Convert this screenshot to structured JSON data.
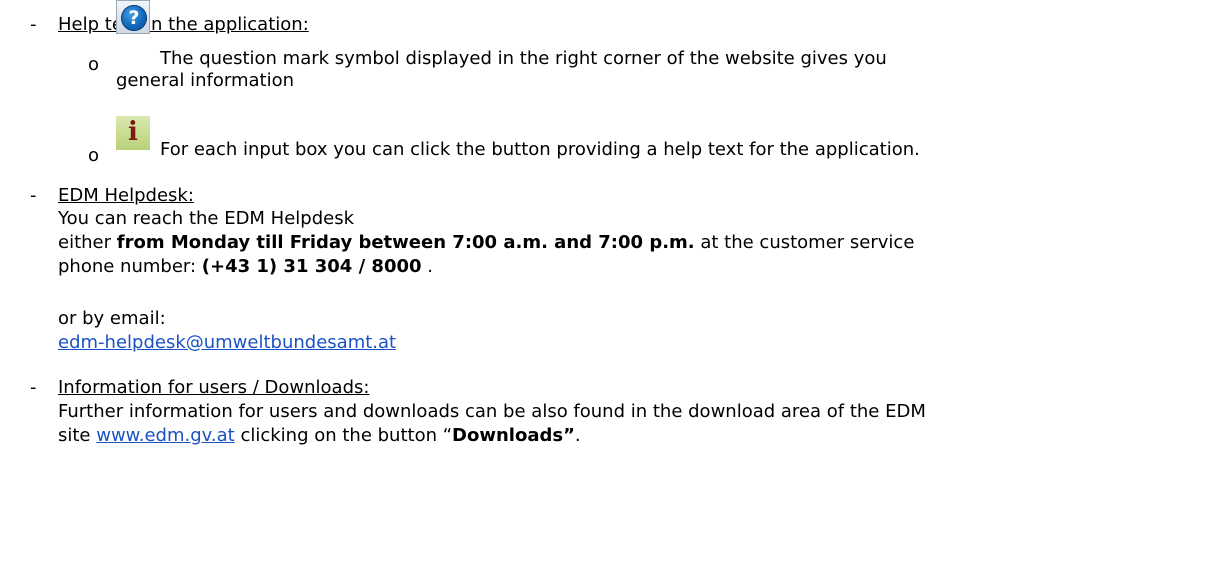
{
  "bullets": {
    "dash": "-",
    "sub": "o"
  },
  "help_section": {
    "heading": "Help text in the application:",
    "item1_text_line1": "The question mark symbol displayed in the right corner of the website gives you",
    "item1_text_line2": "general information",
    "item2_text": "For each input box you can click the button providing a help text for the application.",
    "question_icon_glyph": "?",
    "info_icon_glyph": "i"
  },
  "helpdesk_section": {
    "heading": "EDM Helpdesk:",
    "line1": "You can reach the EDM Helpdesk",
    "line2_prefix": "either ",
    "line2_bold": "from Monday till Friday between 7:00 a.m. and 7:00 p.m.",
    "line2_suffix": " at the customer service",
    "line3_prefix": "phone number: ",
    "phone": "(+43 1) 31 304 / 8000",
    "line3_suffix": " .",
    "email_intro": "or by email:",
    "email": "edm-helpdesk@umweltbundesamt.at"
  },
  "downloads_section": {
    "heading": "Information for users / Downloads:",
    "line1": "Further information for users and downloads can be also found in the download area of the EDM",
    "line2_prefix": "site ",
    "site_link": "www.edm.gv.at",
    "line2_middle": " clicking on the button “",
    "button_name": "Downloads”",
    "line2_suffix": "."
  },
  "colors": {
    "text": "#000000",
    "link": "#1a52c5",
    "question_icon": "#1265b8",
    "info_icon_bg": "#c6dc8a"
  }
}
